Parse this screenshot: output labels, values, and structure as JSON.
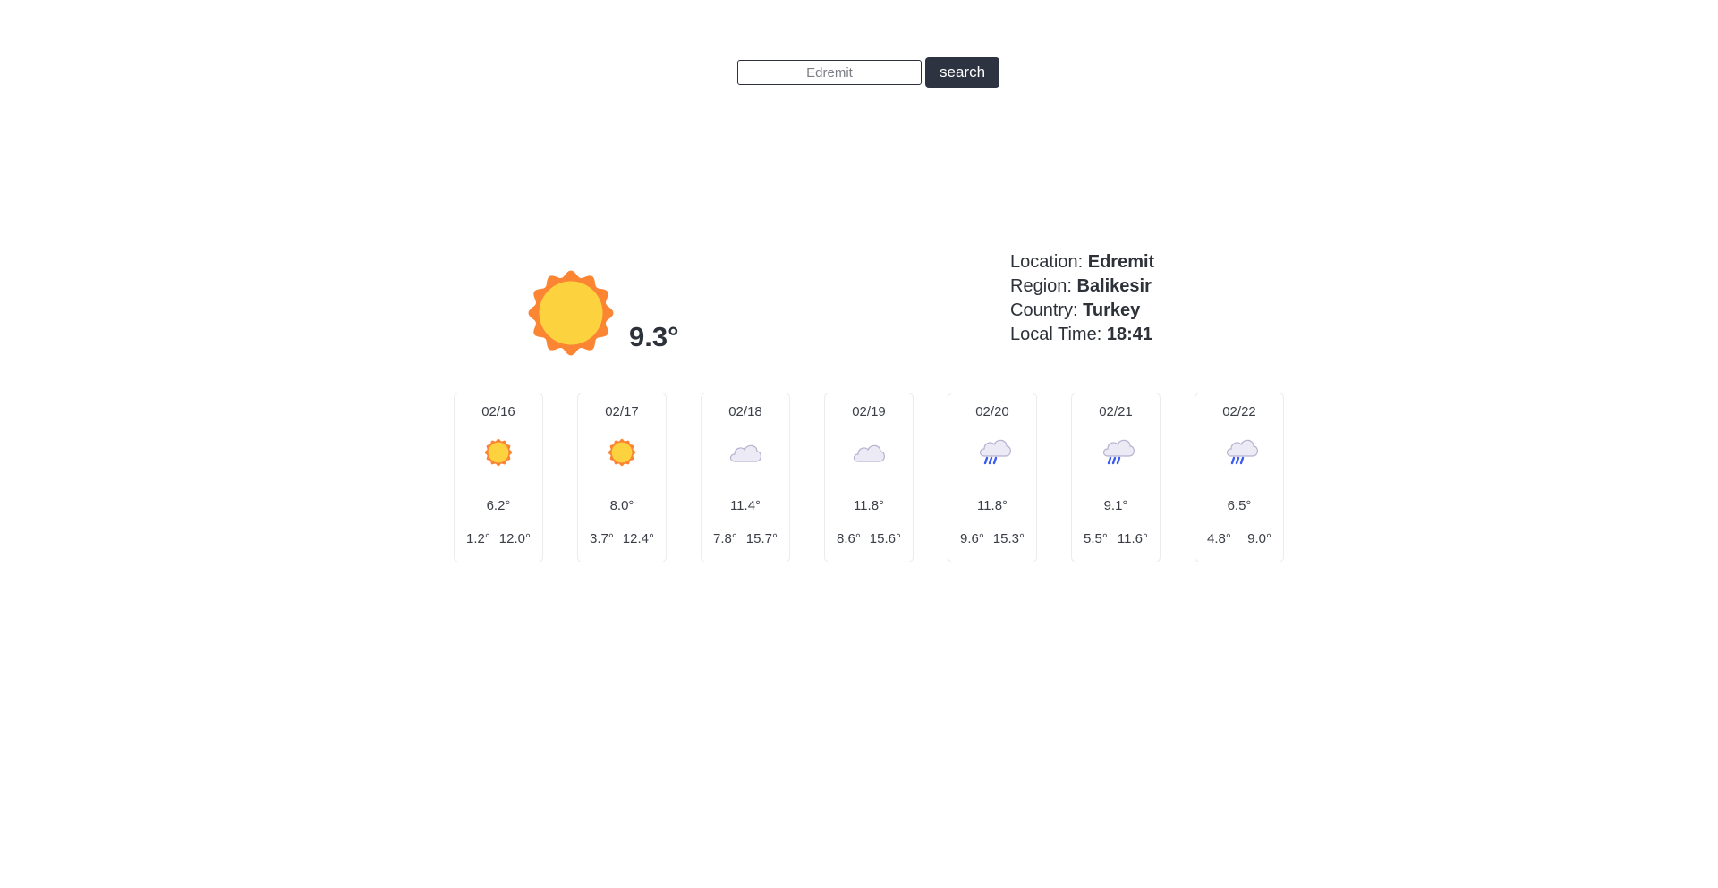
{
  "search": {
    "placeholder": "Edremit",
    "button_label": "search"
  },
  "current": {
    "icon": "sun-icon",
    "temperature": "9.3°"
  },
  "location": {
    "location_label": "Location:",
    "location_value": "Edremit",
    "region_label": "Region:",
    "region_value": "Balikesir",
    "country_label": "Country:",
    "country_value": "Turkey",
    "time_label": "Local Time:",
    "time_value": "18:41"
  },
  "colors": {
    "sun_outer": "#fb8533",
    "sun_inner": "#fcd33f",
    "cloud_fill": "#ecebf5",
    "cloud_stroke": "#b7b1cf",
    "rain": "#3b5bf0",
    "button_bg": "#2d3340"
  },
  "forecast": [
    {
      "date": "02/16",
      "icon": "sun-icon",
      "avg": "6.2°",
      "min": "1.2°",
      "max": "12.0°"
    },
    {
      "date": "02/17",
      "icon": "sun-icon",
      "avg": "8.0°",
      "min": "3.7°",
      "max": "12.4°"
    },
    {
      "date": "02/18",
      "icon": "cloud-icon",
      "avg": "11.4°",
      "min": "7.8°",
      "max": "15.7°"
    },
    {
      "date": "02/19",
      "icon": "cloud-icon",
      "avg": "11.8°",
      "min": "8.6°",
      "max": "15.6°"
    },
    {
      "date": "02/20",
      "icon": "rain-cloud-icon",
      "avg": "11.8°",
      "min": "9.6°",
      "max": "15.3°"
    },
    {
      "date": "02/21",
      "icon": "rain-cloud-icon",
      "avg": "9.1°",
      "min": "5.5°",
      "max": "11.6°"
    },
    {
      "date": "02/22",
      "icon": "rain-cloud-icon",
      "avg": "6.5°",
      "min": "4.8°",
      "max": "9.0°"
    }
  ]
}
